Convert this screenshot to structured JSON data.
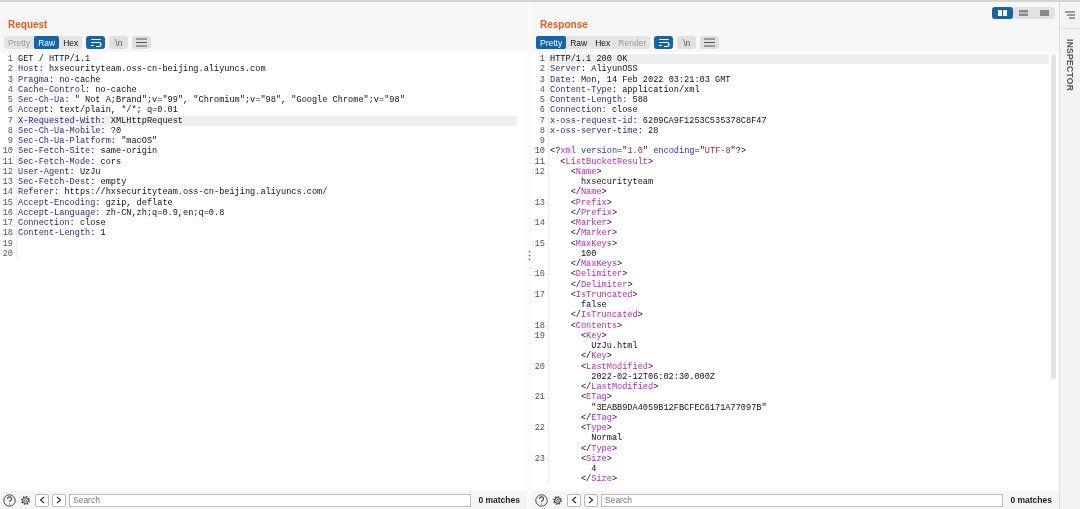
{
  "views": [
    {
      "kind": "split-columns",
      "selected": true
    },
    {
      "kind": "split-rows",
      "selected": false
    },
    {
      "kind": "single",
      "selected": false
    }
  ],
  "request": {
    "title": "Request",
    "tabs": [
      {
        "label": "Pretty",
        "selected": false,
        "disabled": true
      },
      {
        "label": "Raw",
        "selected": true,
        "disabled": false
      },
      {
        "label": "Hex",
        "selected": false,
        "disabled": false
      }
    ],
    "tools": [
      {
        "kind": "wrap",
        "on": true
      },
      {
        "kind": "newline",
        "label": "\\n",
        "on": false
      },
      {
        "kind": "menu",
        "on": false
      }
    ],
    "lines": [
      {
        "number": "1",
        "current": false,
        "tokens": [
          {
            "kind": "text",
            "text": "GET / HTTP/1.1"
          }
        ]
      },
      {
        "number": "2",
        "current": false,
        "tokens": [
          {
            "kind": "name",
            "text": "Host"
          },
          {
            "kind": "text",
            "text": ": hxsecurityteam.oss-cn-beijing.aliyuncs.com"
          }
        ]
      },
      {
        "number": "3",
        "current": false,
        "tokens": [
          {
            "kind": "name",
            "text": "Pragma"
          },
          {
            "kind": "text",
            "text": ": no-cache"
          }
        ]
      },
      {
        "number": "4",
        "current": false,
        "tokens": [
          {
            "kind": "name",
            "text": "Cache-Control"
          },
          {
            "kind": "text",
            "text": ": no-cache"
          }
        ]
      },
      {
        "number": "5",
        "current": false,
        "tokens": [
          {
            "kind": "name",
            "text": "Sec-Ch-Ua"
          },
          {
            "kind": "text",
            "text": ": \" Not A;Brand\";v=\"99\", \"Chromium\";v=\"98\", \"Google Chrome\";v=\"98\""
          }
        ]
      },
      {
        "number": "6",
        "current": false,
        "tokens": [
          {
            "kind": "name",
            "text": "Accept"
          },
          {
            "kind": "text",
            "text": ": text/plain, */*; q=0.01"
          }
        ]
      },
      {
        "number": "7",
        "current": true,
        "tokens": [
          {
            "kind": "name",
            "text": "X-Requested-With"
          },
          {
            "kind": "text",
            "text": ": XMLHttpRequest"
          }
        ]
      },
      {
        "number": "8",
        "current": false,
        "tokens": [
          {
            "kind": "name",
            "text": "Sec-Ch-Ua-Mobile"
          },
          {
            "kind": "text",
            "text": ": ?0"
          }
        ]
      },
      {
        "number": "9",
        "current": false,
        "tokens": [
          {
            "kind": "name",
            "text": "Sec-Ch-Ua-Platform"
          },
          {
            "kind": "text",
            "text": ": \"macOS\""
          }
        ]
      },
      {
        "number": "10",
        "current": false,
        "tokens": [
          {
            "kind": "name",
            "text": "Sec-Fetch-Site"
          },
          {
            "kind": "text",
            "text": ": same-origin"
          }
        ]
      },
      {
        "number": "11",
        "current": false,
        "tokens": [
          {
            "kind": "name",
            "text": "Sec-Fetch-Mode"
          },
          {
            "kind": "text",
            "text": ": cors"
          }
        ]
      },
      {
        "number": "12",
        "current": false,
        "tokens": [
          {
            "kind": "name",
            "text": "User-Agent"
          },
          {
            "kind": "text",
            "text": ": UzJu"
          }
        ]
      },
      {
        "number": "13",
        "current": false,
        "tokens": [
          {
            "kind": "name",
            "text": "Sec-Fetch-Dest"
          },
          {
            "kind": "text",
            "text": ": empty"
          }
        ]
      },
      {
        "number": "14",
        "current": false,
        "tokens": [
          {
            "kind": "name",
            "text": "Referer"
          },
          {
            "kind": "text",
            "text": ": https://hxsecurityteam.oss-cn-beijing.aliyuncs.com/"
          }
        ]
      },
      {
        "number": "15",
        "current": false,
        "tokens": [
          {
            "kind": "name",
            "text": "Accept-Encoding"
          },
          {
            "kind": "text",
            "text": ": gzip, deflate"
          }
        ]
      },
      {
        "number": "16",
        "current": false,
        "tokens": [
          {
            "kind": "name",
            "text": "Accept-Language"
          },
          {
            "kind": "text",
            "text": ": zh-CN,zh;q=0.9,en;q=0.8"
          }
        ]
      },
      {
        "number": "17",
        "current": false,
        "tokens": [
          {
            "kind": "name",
            "text": "Connection"
          },
          {
            "kind": "text",
            "text": ": close"
          }
        ]
      },
      {
        "number": "18",
        "current": false,
        "tokens": [
          {
            "kind": "name",
            "text": "Content-Length"
          },
          {
            "kind": "text",
            "text": ": 1"
          }
        ]
      },
      {
        "number": "19",
        "current": false
      },
      {
        "number": "20",
        "current": false
      }
    ],
    "search": {
      "placeholder": "Search",
      "matches": "0 matches"
    }
  },
  "response": {
    "title": "Response",
    "tabs": [
      {
        "label": "Pretty",
        "selected": true,
        "disabled": false
      },
      {
        "label": "Raw",
        "selected": false,
        "disabled": false
      },
      {
        "label": "Hex",
        "selected": false,
        "disabled": false
      },
      {
        "label": "Render",
        "selected": false,
        "disabled": true
      }
    ],
    "tools": [
      {
        "kind": "wrap",
        "on": true
      },
      {
        "kind": "newline",
        "label": "\\n",
        "on": false
      },
      {
        "kind": "menu",
        "on": false
      }
    ],
    "lines": [
      {
        "number": "1",
        "current": true,
        "tokens": [
          {
            "kind": "text",
            "text": "HTTP/1.1 200 OK"
          }
        ]
      },
      {
        "number": "2",
        "current": false,
        "tokens": [
          {
            "kind": "name",
            "text": "Server"
          },
          {
            "kind": "text",
            "text": ": AliyunOSS"
          }
        ]
      },
      {
        "number": "3",
        "current": false,
        "tokens": [
          {
            "kind": "name",
            "text": "Date"
          },
          {
            "kind": "text",
            "text": ": Mon, 14 Feb 2022 03:21:03 GMT"
          }
        ]
      },
      {
        "number": "4",
        "current": false,
        "tokens": [
          {
            "kind": "name",
            "text": "Content-Type"
          },
          {
            "kind": "text",
            "text": ": application/xml"
          }
        ]
      },
      {
        "number": "5",
        "current": false,
        "tokens": [
          {
            "kind": "name",
            "text": "Content-Length"
          },
          {
            "kind": "text",
            "text": ": 588"
          }
        ]
      },
      {
        "number": "6",
        "current": false,
        "tokens": [
          {
            "kind": "name",
            "text": "Connection"
          },
          {
            "kind": "text",
            "text": ": close"
          }
        ]
      },
      {
        "number": "7",
        "current": false,
        "tokens": [
          {
            "kind": "name",
            "text": "x-oss-request-id"
          },
          {
            "kind": "text",
            "text": ": 6209CA9F1253C535378C8F47"
          }
        ]
      },
      {
        "number": "8",
        "current": false,
        "tokens": [
          {
            "kind": "name",
            "text": "x-oss-server-time"
          },
          {
            "kind": "text",
            "text": ": 28"
          }
        ]
      },
      {
        "number": "9",
        "current": false
      },
      {
        "number": "10",
        "current": false,
        "tokens": [
          {
            "kind": "text",
            "text": "<?"
          },
          {
            "kind": "tag",
            "text": "xml"
          },
          {
            "kind": "attr",
            "text": " version"
          },
          {
            "kind": "text",
            "text": "=\""
          },
          {
            "kind": "string",
            "text": "1.0"
          },
          {
            "kind": "text",
            "text": "\" "
          },
          {
            "kind": "attr",
            "text": "encoding"
          },
          {
            "kind": "text",
            "text": "=\""
          },
          {
            "kind": "string",
            "text": "UTF-8"
          },
          {
            "kind": "text",
            "text": "\"?>"
          }
        ]
      },
      {
        "number": "11",
        "current": false,
        "tokens": [
          {
            "kind": "text",
            "text": "  <"
          },
          {
            "kind": "tag",
            "text": "ListBucketResult"
          },
          {
            "kind": "text",
            "text": ">"
          }
        ]
      },
      {
        "number": "12",
        "current": false,
        "tokens": [
          {
            "kind": "text",
            "text": "    <"
          },
          {
            "kind": "tag",
            "text": "Name"
          },
          {
            "kind": "text",
            "text": ">"
          }
        ]
      },
      {
        "current": false,
        "tokens": [
          {
            "kind": "text",
            "text": "      hxsecurityteam"
          }
        ]
      },
      {
        "current": false,
        "tokens": [
          {
            "kind": "text",
            "text": "    </"
          },
          {
            "kind": "tag",
            "text": "Name"
          },
          {
            "kind": "text",
            "text": ">"
          }
        ]
      },
      {
        "number": "13",
        "current": false,
        "tokens": [
          {
            "kind": "text",
            "text": "    <"
          },
          {
            "kind": "tag",
            "text": "Prefix"
          },
          {
            "kind": "text",
            "text": ">"
          }
        ]
      },
      {
        "current": false,
        "tokens": [
          {
            "kind": "text",
            "text": "    </"
          },
          {
            "kind": "tag",
            "text": "Prefix"
          },
          {
            "kind": "text",
            "text": ">"
          }
        ]
      },
      {
        "number": "14",
        "current": false,
        "tokens": [
          {
            "kind": "text",
            "text": "    <"
          },
          {
            "kind": "tag",
            "text": "Marker"
          },
          {
            "kind": "text",
            "text": ">"
          }
        ]
      },
      {
        "current": false,
        "tokens": [
          {
            "kind": "text",
            "text": "    </"
          },
          {
            "kind": "tag",
            "text": "Marker"
          },
          {
            "kind": "text",
            "text": ">"
          }
        ]
      },
      {
        "number": "15",
        "current": false,
        "tokens": [
          {
            "kind": "text",
            "text": "    <"
          },
          {
            "kind": "tag",
            "text": "MaxKeys"
          },
          {
            "kind": "text",
            "text": ">"
          }
        ]
      },
      {
        "current": false,
        "tokens": [
          {
            "kind": "text",
            "text": "      100"
          }
        ]
      },
      {
        "current": false,
        "tokens": [
          {
            "kind": "text",
            "text": "    </"
          },
          {
            "kind": "tag",
            "text": "MaxKeys"
          },
          {
            "kind": "text",
            "text": ">"
          }
        ]
      },
      {
        "number": "16",
        "current": false,
        "tokens": [
          {
            "kind": "text",
            "text": "    <"
          },
          {
            "kind": "tag",
            "text": "Delimiter"
          },
          {
            "kind": "text",
            "text": ">"
          }
        ]
      },
      {
        "current": false,
        "tokens": [
          {
            "kind": "text",
            "text": "    </"
          },
          {
            "kind": "tag",
            "text": "Delimiter"
          },
          {
            "kind": "text",
            "text": ">"
          }
        ]
      },
      {
        "number": "17",
        "current": false,
        "tokens": [
          {
            "kind": "text",
            "text": "    <"
          },
          {
            "kind": "tag",
            "text": "IsTruncated"
          },
          {
            "kind": "text",
            "text": ">"
          }
        ]
      },
      {
        "current": false,
        "tokens": [
          {
            "kind": "text",
            "text": "      false"
          }
        ]
      },
      {
        "current": false,
        "tokens": [
          {
            "kind": "text",
            "text": "    </"
          },
          {
            "kind": "tag",
            "text": "IsTruncated"
          },
          {
            "kind": "text",
            "text": ">"
          }
        ]
      },
      {
        "number": "18",
        "current": false,
        "tokens": [
          {
            "kind": "text",
            "text": "    <"
          },
          {
            "kind": "tag",
            "text": "Contents"
          },
          {
            "kind": "text",
            "text": ">"
          }
        ]
      },
      {
        "number": "19",
        "current": false,
        "tokens": [
          {
            "kind": "text",
            "text": "      <"
          },
          {
            "kind": "tag",
            "text": "Key"
          },
          {
            "kind": "text",
            "text": ">"
          }
        ]
      },
      {
        "current": false,
        "tokens": [
          {
            "kind": "text",
            "text": "        UzJu.html"
          }
        ]
      },
      {
        "current": false,
        "tokens": [
          {
            "kind": "text",
            "text": "      </"
          },
          {
            "kind": "tag",
            "text": "Key"
          },
          {
            "kind": "text",
            "text": ">"
          }
        ]
      },
      {
        "number": "20",
        "current": false,
        "tokens": [
          {
            "kind": "text",
            "text": "      <"
          },
          {
            "kind": "tag",
            "text": "LastModified"
          },
          {
            "kind": "text",
            "text": ">"
          }
        ]
      },
      {
        "current": false,
        "tokens": [
          {
            "kind": "text",
            "text": "        2022-02-12T06:02:30.000Z"
          }
        ]
      },
      {
        "current": false,
        "tokens": [
          {
            "kind": "text",
            "text": "      </"
          },
          {
            "kind": "tag",
            "text": "LastModified"
          },
          {
            "kind": "text",
            "text": ">"
          }
        ]
      },
      {
        "number": "21",
        "current": false,
        "tokens": [
          {
            "kind": "text",
            "text": "      <"
          },
          {
            "kind": "tag",
            "text": "ETag"
          },
          {
            "kind": "text",
            "text": ">"
          }
        ]
      },
      {
        "current": false,
        "tokens": [
          {
            "kind": "text",
            "text": "        \"3EABB9DA4059B12FBCFEC6171A77097B\""
          }
        ]
      },
      {
        "current": false,
        "tokens": [
          {
            "kind": "text",
            "text": "      </"
          },
          {
            "kind": "tag",
            "text": "ETag"
          },
          {
            "kind": "text",
            "text": ">"
          }
        ]
      },
      {
        "number": "22",
        "current": false,
        "tokens": [
          {
            "kind": "text",
            "text": "      <"
          },
          {
            "kind": "tag",
            "text": "Type"
          },
          {
            "kind": "text",
            "text": ">"
          }
        ]
      },
      {
        "current": false,
        "tokens": [
          {
            "kind": "text",
            "text": "        Normal"
          }
        ]
      },
      {
        "current": false,
        "tokens": [
          {
            "kind": "text",
            "text": "      </"
          },
          {
            "kind": "tag",
            "text": "Type"
          },
          {
            "kind": "text",
            "text": ">"
          }
        ]
      },
      {
        "number": "23",
        "current": false,
        "tokens": [
          {
            "kind": "text",
            "text": "      <"
          },
          {
            "kind": "tag",
            "text": "Size"
          },
          {
            "kind": "text",
            "text": ">"
          }
        ]
      },
      {
        "current": false,
        "tokens": [
          {
            "kind": "text",
            "text": "        4"
          }
        ]
      },
      {
        "current": false,
        "tokens": [
          {
            "kind": "text",
            "text": "      </"
          },
          {
            "kind": "tag",
            "text": "Size"
          },
          {
            "kind": "text",
            "text": ">"
          }
        ]
      }
    ],
    "search": {
      "placeholder": "Search",
      "matches": "0 matches"
    }
  },
  "inspector": {
    "title": "INSPECTOR"
  }
}
